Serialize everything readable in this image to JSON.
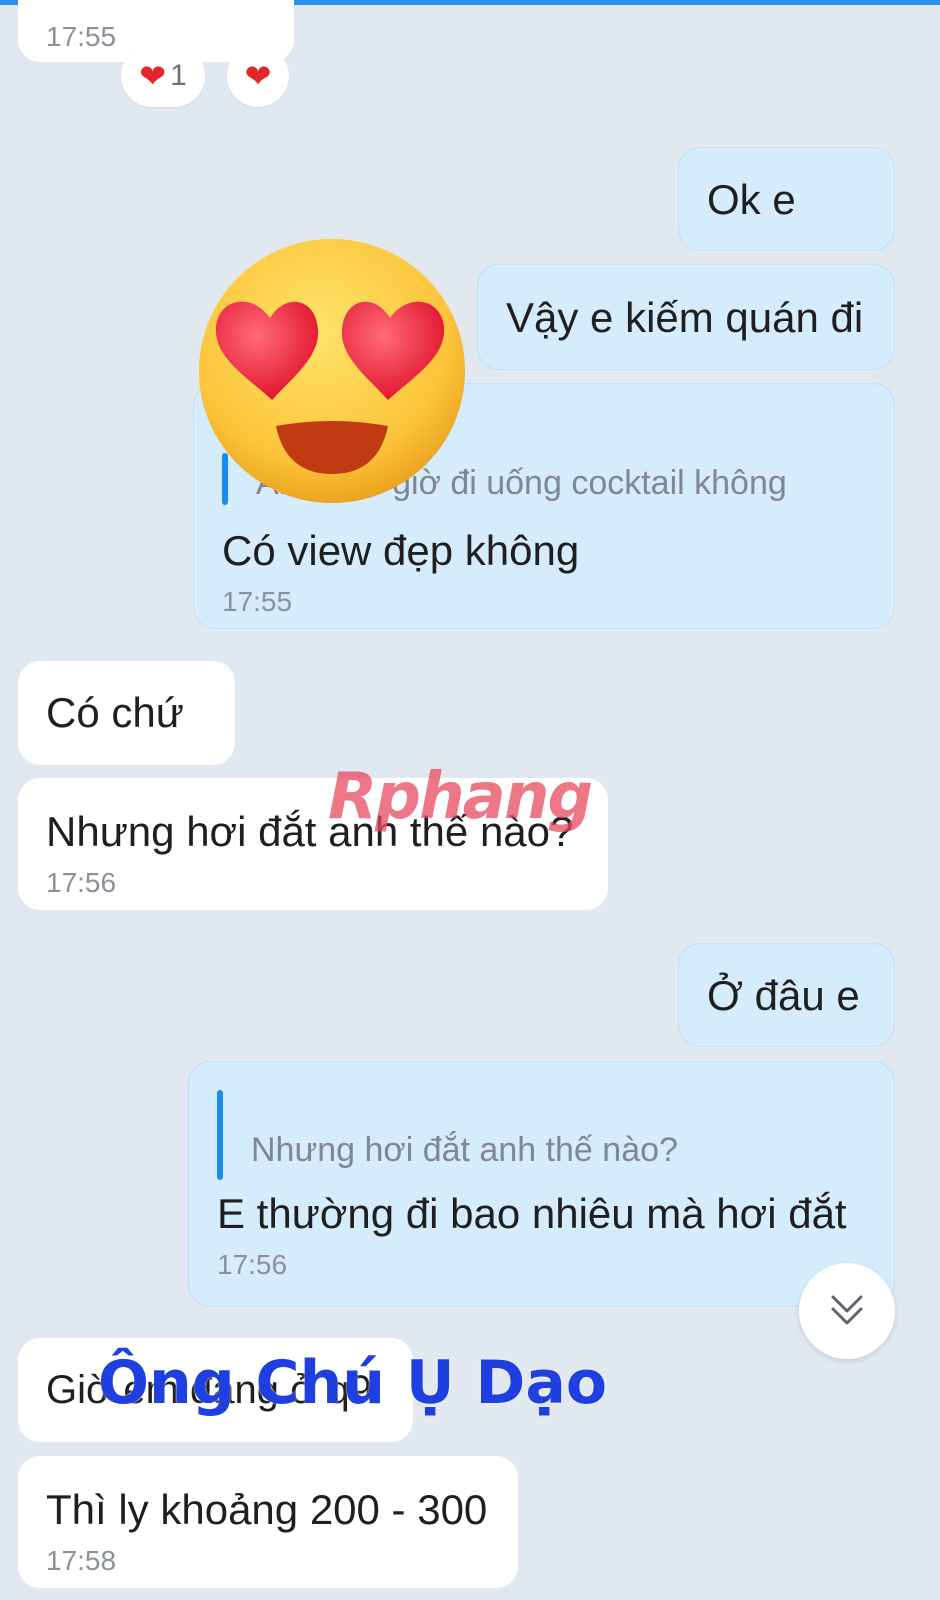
{
  "messages": [
    {
      "id": "m0",
      "side": "received",
      "time": "17:55"
    },
    {
      "id": "m1",
      "side": "sent",
      "text": "Ok e"
    },
    {
      "id": "m2",
      "side": "sent",
      "text": "Vậy e kiếm quán đi"
    },
    {
      "id": "m3",
      "side": "sent",
      "quote": "Anh bao giờ đi uống cocktail không",
      "text": "Có view đẹp không",
      "time": "17:55"
    },
    {
      "id": "m4",
      "side": "received",
      "text": "Có chứ"
    },
    {
      "id": "m5",
      "side": "received",
      "text": "Nhưng hơi đắt anh thế nào?",
      "time": "17:56"
    },
    {
      "id": "m6",
      "side": "sent",
      "text": "Ở đâu e"
    },
    {
      "id": "m7",
      "side": "sent",
      "quote": "Nhưng hơi đắt anh thế nào?",
      "text": "E thường đi bao nhiêu mà hơi đắt",
      "time": "17:56"
    },
    {
      "id": "m8",
      "side": "received",
      "text": "Giờ em đang ở q9"
    },
    {
      "id": "m9",
      "side": "received",
      "text": "Thì ly khoảng 200 - 300",
      "time": "17:58"
    }
  ],
  "reactions": [
    {
      "icon": "heart-icon",
      "count": "1"
    },
    {
      "icon": "heart-icon"
    }
  ],
  "overlays": {
    "emoji": "heart-eyes-emoji",
    "brand_watermark": "Rphang",
    "caption": "Ông Chú Ụ Dạo"
  },
  "colors": {
    "background": "#e2e8ef",
    "sent_bubble": "#d5ecfc",
    "received_bubble": "#ffffff",
    "quote_bar": "#1a8cf0",
    "accent": "#2f8df6",
    "caption": "#1f3fe0"
  },
  "scroll_button": {
    "icon": "double-chevron-down-icon"
  }
}
